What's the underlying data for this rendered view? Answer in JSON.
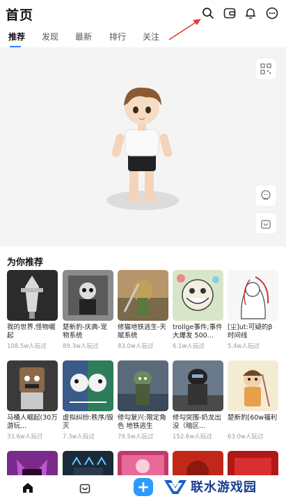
{
  "header": {
    "title": "首页",
    "icons": [
      "search-icon",
      "wallet-icon",
      "bell-icon",
      "more-icon"
    ]
  },
  "tabs": [
    {
      "label": "推荐",
      "active": true
    },
    {
      "label": "发现",
      "active": false
    },
    {
      "label": "最新",
      "active": false
    },
    {
      "label": "排行",
      "active": false
    },
    {
      "label": "关注",
      "active": false
    }
  ],
  "stage": {
    "buttons": [
      "qr-scan-icon",
      "emote-icon",
      "shop-bag-icon"
    ]
  },
  "recommend": {
    "title": "为你推荐",
    "rows": [
      [
        {
          "name": "我的世界.怪物崛起",
          "plays": "108.5w人玩过"
        },
        {
          "name": "楚新豹-庆典-宠物系统",
          "plays": "89.3w人玩过"
        },
        {
          "name": "修猫地铁逃生-天赋系统",
          "plays": "83.0w人玩过"
        },
        {
          "name": "trollge事件;事件大爆发 500...",
          "plays": "6.1w人玩过"
        },
        {
          "name": "[尘]ut:可疑的β时间线",
          "plays": "5.4w人玩过"
        }
      ],
      [
        {
          "name": "马桶人崛起(30万游玩...",
          "plays": "33.6w人玩过"
        },
        {
          "name": "虚拟纠纷:秩序/毁灭",
          "plays": "7.3w人玩过"
        },
        {
          "name": "修勾复兴:限定角色 地铁逃生",
          "plays": "79.5w人玩过"
        },
        {
          "name": "修勾突围-奶龙出没（暗区...",
          "plays": "152.6w人玩过"
        },
        {
          "name": "楚新豹[60w福利",
          "plays": "63.0w人玩过"
        }
      ]
    ]
  },
  "bottom_nav": {
    "icons": [
      "home-icon",
      "bag-icon",
      "plus-icon"
    ],
    "plus_label": "+"
  },
  "watermark": {
    "text": "联水游戏园"
  },
  "colors": {
    "accent": "#2b7fff",
    "plus": "#2b9bff",
    "arrow": "#e53935",
    "watermark": "#1a3d8f"
  }
}
